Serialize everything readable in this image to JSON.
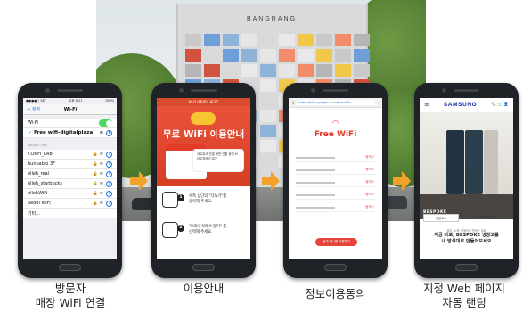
{
  "colors": {
    "arrow": "#f3a12a",
    "accent_red": "#e33a2c",
    "ios_blue": "#1a73e8",
    "samsung_blue": "#1428a0"
  },
  "building": {
    "sign": "BANGRANG"
  },
  "phone1": {
    "status_left": "●●●●○ SKT",
    "status_time": "오후 8:21",
    "status_right": "100%",
    "back_label": "< 설정",
    "title": "Wi-Fi",
    "wifi_label": "Wi-Fi",
    "selected_network": "Free wifi-digitalplaza",
    "section_header": "네트워크 선택...",
    "networks": [
      "CONFI_LAB",
      "hunuabio 3F",
      "olleh_real",
      "olleh_starbucks",
      "ollehWiFi",
      "Seoul WiFi"
    ],
    "other": "기타..."
  },
  "phone2": {
    "top_bar": "Wi-Fi 네트워크 로그인",
    "title": "무료 WiFi 이용안내",
    "bubble": "네트워크 연결 화면 연결 중이 브라우저에서 열기",
    "step1_text_a": "우측 상단의 \"더보기\"를",
    "step1_text_b": "클릭해 주세요.",
    "step1_num": "1",
    "step2_text_a": "\"브라우저에서 열기\" 를",
    "step2_text_b": "선택해 주세요.",
    "step2_num": "2"
  },
  "phone3": {
    "url": "https://www.google.co.kr/search?q",
    "title": "Free WiFi",
    "button": "동의 하시면 이용하기"
  },
  "phone4": {
    "brand": "SAMSUNG",
    "menu_icon": "≡",
    "header_icons": "🔍 🛒 👤",
    "bespoke": "BESPOKE",
    "chip1": "냉장고 ▾",
    "chip2": "BESPOKE 냉장고",
    "tagline_small": "컬러, 소재, 모듈까지 원하는 대로",
    "tagline_line1": "지금 바로, BESPOKE 냉장고를",
    "tagline_line2": "내 방식대로 만들어보세요"
  },
  "captions": {
    "c1_line1": "방문자",
    "c1_line2": "매장 WiFi 연결",
    "c2": "이용안내",
    "c3": "정보이용동의",
    "c4_line1": "지정 Web 페이지",
    "c4_line2": "자동 랜딩"
  }
}
